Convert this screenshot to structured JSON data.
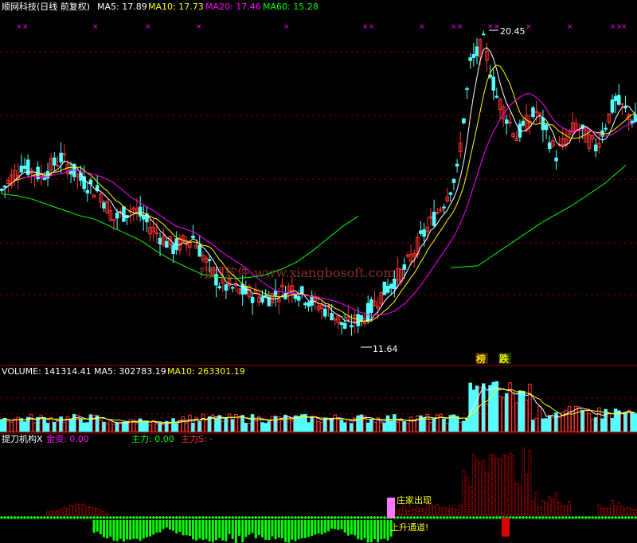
{
  "colors": {
    "background": "#000000",
    "up": "#ff3232",
    "down": "#54ffff",
    "ma5": "#ffffff",
    "ma10": "#ffff00",
    "ma20": "#ff00ff",
    "ma60": "#00ff00",
    "grid": "#7a0000",
    "divider": "#b00000",
    "main_force": "#00ff00",
    "main_force_s": "#ff3030",
    "fund_in": "#ff00ff",
    "label_white": "#ffffff"
  },
  "price_panel": {
    "title": "顺网科技(日线 前复权)",
    "ma5_label": "MA5: 17.89",
    "ma10_label": "MA10: 17.73",
    "ma20_label": "MA20: 17.46",
    "ma60_label": "MA60: 15.28",
    "high_label": "20.45",
    "low_label": "11.64",
    "badge_bang": "榜",
    "badge_die": "跌",
    "watermark": "翔博软件 www.xiangbosoft.com",
    "x_marker": "××",
    "scale": {
      "price_min": 11.3,
      "price_max": 20.75
    }
  },
  "volume_panel": {
    "volume_label": "VOLUME: 141314.41",
    "ma5_label": "MA5: 302783.19",
    "ma10_label": "MA10: 263301.19"
  },
  "indicator_panel": {
    "name": "提刀机构X",
    "fund_label": "金资: 0.00",
    "main_force_label": "主力: 0.00",
    "main_force_s_label": "主力S: -",
    "zhuangjia_label": "庄家出现",
    "shangsheng_label": "上升通道!"
  },
  "chart_data": {
    "type": "candlestick",
    "title": "顺网科技(日线 前复权)",
    "annotations": {
      "high": 20.45,
      "low": 11.64
    },
    "moving_averages": {
      "MA5": 17.89,
      "MA10": 17.73,
      "MA20": 17.46,
      "MA60": 15.28
    },
    "volume": {
      "VOLUME": 141314.41,
      "MA5": 302783.19,
      "MA10": 263301.19
    },
    "ma60_path": [
      15.9,
      15.85,
      15.75,
      15.6,
      15.45,
      15.3,
      15.2,
      15.0,
      14.8,
      14.6,
      14.3,
      14.05,
      13.85,
      13.65,
      13.58,
      13.55,
      13.58,
      13.65,
      13.8,
      14.0,
      14.3,
      14.65,
      15.0,
      15.28
    ],
    "candles_summary": "approximately 160 daily candles; range 11.64 to 20.45"
  }
}
